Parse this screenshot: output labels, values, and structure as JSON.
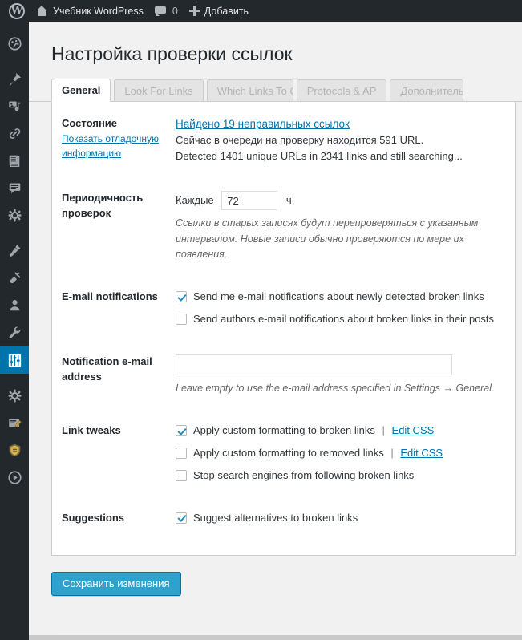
{
  "adminbar": {
    "logo_icon": "wordpress-logo-icon",
    "home_icon": "home-icon",
    "site_name": "Учебник WordPress",
    "comments_icon": "comment-bubble-icon",
    "comments_count": "0",
    "plus_icon": "plus-icon",
    "new_label": "Добавить"
  },
  "adminmenu": {
    "items": [
      {
        "name": "dashboard-icon",
        "label": "Консоль"
      },
      {
        "name": "posts-pin-icon",
        "label": "Записи"
      },
      {
        "name": "media-icon",
        "label": "Медиафайлы"
      },
      {
        "name": "links-icon",
        "label": "Ссылки"
      },
      {
        "name": "pages-icon",
        "label": "Страницы"
      },
      {
        "name": "comments-icon",
        "label": "Комментарии"
      },
      {
        "name": "settings-gear-icon",
        "label": "Настройки"
      },
      {
        "name": "appearance-brush-icon",
        "label": "Внешний вид"
      },
      {
        "name": "plugins-plug-icon",
        "label": "Плагины"
      },
      {
        "name": "users-icon",
        "label": "Пользователи"
      },
      {
        "name": "tools-wrench-icon",
        "label": "Инструменты"
      },
      {
        "name": "link-checker-sliders-icon",
        "label": "Проверка ссылок",
        "active": true
      },
      {
        "name": "settings-gear-icon-2",
        "label": "Настройки"
      },
      {
        "name": "seo-icon",
        "label": "SEO"
      },
      {
        "name": "security-shield-icon",
        "label": "Безопасность"
      },
      {
        "name": "player-icon",
        "label": "Плеер"
      }
    ]
  },
  "page": {
    "title": "Настройка проверки ссылок"
  },
  "tabs": [
    {
      "label": "General",
      "active": true
    },
    {
      "label": "Look For Links",
      "active": false
    },
    {
      "label": "Which Links To Che",
      "active": false
    },
    {
      "label": "Protocols & AP",
      "active": false
    },
    {
      "label": "Дополнительны",
      "active": false
    }
  ],
  "form": {
    "status": {
      "label": "Состояние",
      "debug_link": "Показать отладочную информацию",
      "broken_links_link": "Найдено 19 неправильных ссылок",
      "queue_line": "Сейчас в очереди на проверку находится 591 URL.",
      "detected_line": "Detected 1401 unique URLs in 2341 links and still searching..."
    },
    "interval": {
      "label": "Периодичность проверок",
      "prefix": "Каждые",
      "value": "72",
      "unit": "ч.",
      "description": "Ссылки в старых записях будут перепроверяться с указанным интервалом. Новые записи обычно проверяются по мере их появления."
    },
    "email_notifications": {
      "label": "E-mail notifications",
      "options": [
        {
          "label": "Send me e-mail notifications about newly detected broken links",
          "checked": true
        },
        {
          "label": "Send authors e-mail notifications about broken links in their posts",
          "checked": false
        }
      ]
    },
    "notification_email": {
      "label": "Notification e-mail address",
      "value": "",
      "placeholder": "",
      "description": "Leave empty to use the e-mail address specified in Settings → General."
    },
    "link_tweaks": {
      "label": "Link tweaks",
      "options": [
        {
          "label": "Apply custom formatting to broken links",
          "checked": true,
          "separator": "|",
          "link": "Edit CSS"
        },
        {
          "label": "Apply custom formatting to removed links",
          "checked": false,
          "separator": "|",
          "link": "Edit CSS"
        },
        {
          "label": "Stop search engines from following broken links",
          "checked": false
        }
      ]
    },
    "suggestions": {
      "label": "Suggestions",
      "options": [
        {
          "label": "Suggest alternatives to broken links",
          "checked": true
        }
      ]
    }
  },
  "submit": {
    "save_label": "Сохранить изменения"
  },
  "colors": {
    "adminbar_bg": "#23282d",
    "menu_active_bg": "#0073aa",
    "accent": "#0073aa",
    "button_bg": "#2ea2cc",
    "check_color": "#1e8cbe",
    "page_bg": "#f1f1f1"
  }
}
